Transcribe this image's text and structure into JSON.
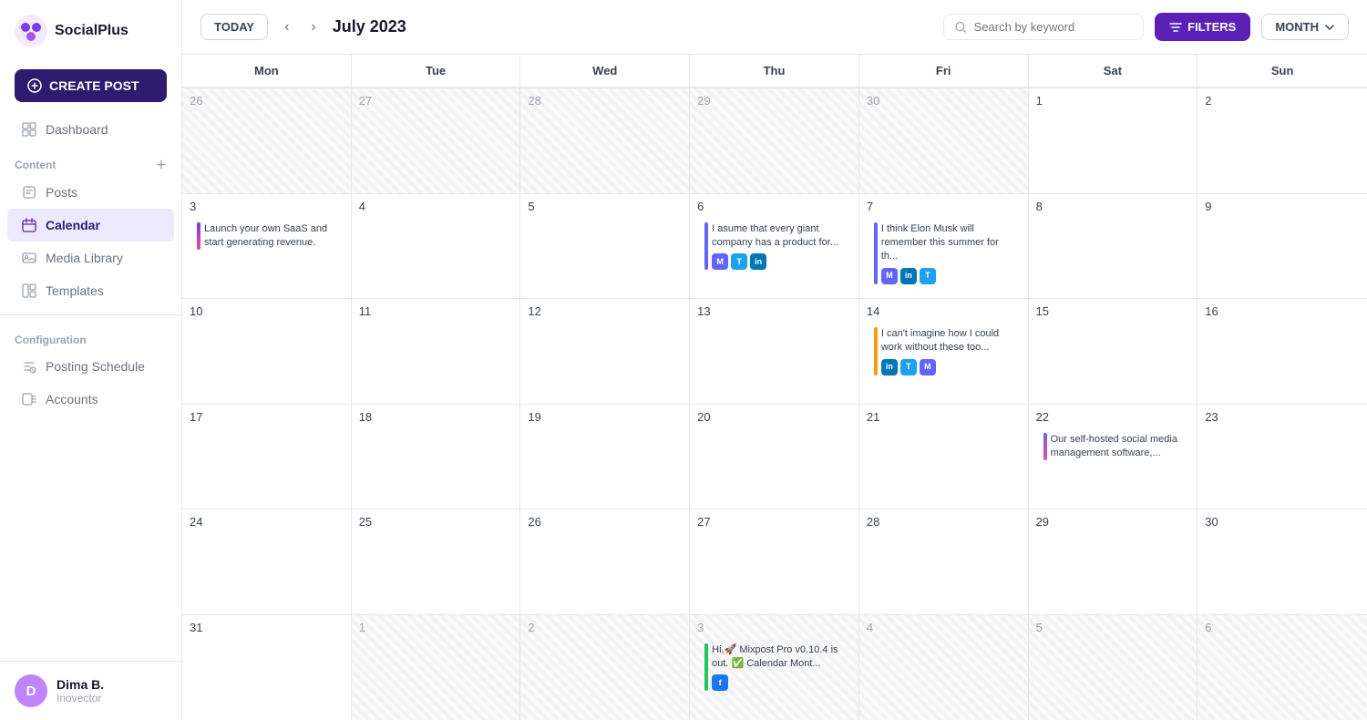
{
  "sidebar": {
    "logo_text": "SocialPlus",
    "create_post_label": "CREATE POST",
    "nav_items": [
      {
        "id": "dashboard",
        "label": "Dashboard",
        "active": false,
        "icon": "dashboard-icon"
      },
      {
        "id": "posts",
        "label": "Posts",
        "active": false,
        "icon": "posts-icon"
      },
      {
        "id": "calendar",
        "label": "Calendar",
        "active": true,
        "icon": "calendar-icon"
      },
      {
        "id": "media",
        "label": "Media Library",
        "active": false,
        "icon": "media-icon"
      },
      {
        "id": "templates",
        "label": "Templates",
        "active": false,
        "icon": "templates-icon"
      }
    ],
    "section_content": "Content",
    "section_configuration": "Configuration",
    "config_items": [
      {
        "id": "schedule",
        "label": "Posting Schedule",
        "icon": "schedule-icon"
      },
      {
        "id": "accounts",
        "label": "Accounts",
        "icon": "accounts-icon"
      }
    ],
    "user": {
      "name": "Dima B.",
      "org": "Inovector",
      "avatar_letter": "D"
    }
  },
  "topbar": {
    "today_label": "TODAY",
    "month_title": "July 2023",
    "search_placeholder": "Search by keyword",
    "filters_label": "FILTERS",
    "month_select_label": "MONTH"
  },
  "calendar": {
    "headers": [
      "Mon",
      "Tue",
      "Wed",
      "Thu",
      "Fri",
      "Sat",
      "Sun"
    ],
    "weeks": [
      {
        "days": [
          {
            "num": "26",
            "other": true,
            "events": []
          },
          {
            "num": "27",
            "other": true,
            "events": []
          },
          {
            "num": "28",
            "other": true,
            "events": []
          },
          {
            "num": "29",
            "other": true,
            "events": []
          },
          {
            "num": "30",
            "other": true,
            "events": []
          },
          {
            "num": "1",
            "other": false,
            "events": []
          },
          {
            "num": "2",
            "other": false,
            "events": []
          }
        ]
      },
      {
        "days": [
          {
            "num": "3",
            "other": false,
            "events": [
              {
                "text": "Launch your own SaaS and start generating revenue.",
                "bar_color": "#7c3aed",
                "bottom_color": "#ec4899",
                "socials": []
              }
            ]
          },
          {
            "num": "4",
            "other": false,
            "events": []
          },
          {
            "num": "5",
            "other": false,
            "events": []
          },
          {
            "num": "6",
            "other": false,
            "events": [
              {
                "text": "I asume that every giant company has a product for...",
                "bar_color": "#6366f1",
                "socials": [
                  "mastodon",
                  "twitter",
                  "linkedin"
                ]
              }
            ]
          },
          {
            "num": "7",
            "other": false,
            "events": [
              {
                "text": "I think Elon Musk will remember this summer for th...",
                "bar_color": "#6366f1",
                "socials": [
                  "mastodon",
                  "linkedin",
                  "twitter"
                ]
              }
            ]
          },
          {
            "num": "8",
            "other": false,
            "events": []
          },
          {
            "num": "9",
            "other": false,
            "events": []
          }
        ]
      },
      {
        "days": [
          {
            "num": "10",
            "other": false,
            "events": []
          },
          {
            "num": "11",
            "other": false,
            "events": []
          },
          {
            "num": "12",
            "other": false,
            "events": []
          },
          {
            "num": "13",
            "other": false,
            "events": []
          },
          {
            "num": "14",
            "other": false,
            "events": [
              {
                "text": "I can't imagine how I could work without these too...",
                "bar_color": "#f59e0b",
                "socials": [
                  "linkedin",
                  "twitter",
                  "mastodon"
                ]
              }
            ]
          },
          {
            "num": "15",
            "other": false,
            "events": []
          },
          {
            "num": "16",
            "other": false,
            "events": []
          }
        ]
      },
      {
        "days": [
          {
            "num": "17",
            "other": false,
            "events": []
          },
          {
            "num": "18",
            "other": false,
            "events": []
          },
          {
            "num": "19",
            "other": false,
            "events": []
          },
          {
            "num": "20",
            "other": false,
            "events": []
          },
          {
            "num": "21",
            "other": false,
            "events": []
          },
          {
            "num": "22",
            "other": false,
            "events": [
              {
                "text": "Our self-hosted social media management software,...",
                "bar_color": "#6366f1",
                "bottom_color": "#ec4899",
                "socials": []
              }
            ]
          },
          {
            "num": "23",
            "other": false,
            "events": []
          }
        ]
      },
      {
        "days": [
          {
            "num": "24",
            "other": false,
            "events": []
          },
          {
            "num": "25",
            "other": false,
            "events": []
          },
          {
            "num": "26",
            "other": false,
            "events": []
          },
          {
            "num": "27",
            "other": false,
            "events": []
          },
          {
            "num": "28",
            "other": false,
            "events": []
          },
          {
            "num": "29",
            "other": false,
            "events": []
          },
          {
            "num": "30",
            "other": false,
            "events": []
          }
        ]
      },
      {
        "days": [
          {
            "num": "31",
            "other": false,
            "events": []
          },
          {
            "num": "1",
            "other": true,
            "events": []
          },
          {
            "num": "2",
            "other": true,
            "events": []
          },
          {
            "num": "3",
            "other": true,
            "events": [
              {
                "text": "Hi,🚀 Mixpost Pro v0.10.4 is out. ✅ Calendar Mont...",
                "bar_color": "#22c55e",
                "socials": [
                  "facebook"
                ]
              }
            ]
          },
          {
            "num": "4",
            "other": true,
            "events": []
          },
          {
            "num": "5",
            "other": true,
            "events": []
          },
          {
            "num": "6",
            "other": true,
            "events": []
          }
        ]
      }
    ]
  }
}
